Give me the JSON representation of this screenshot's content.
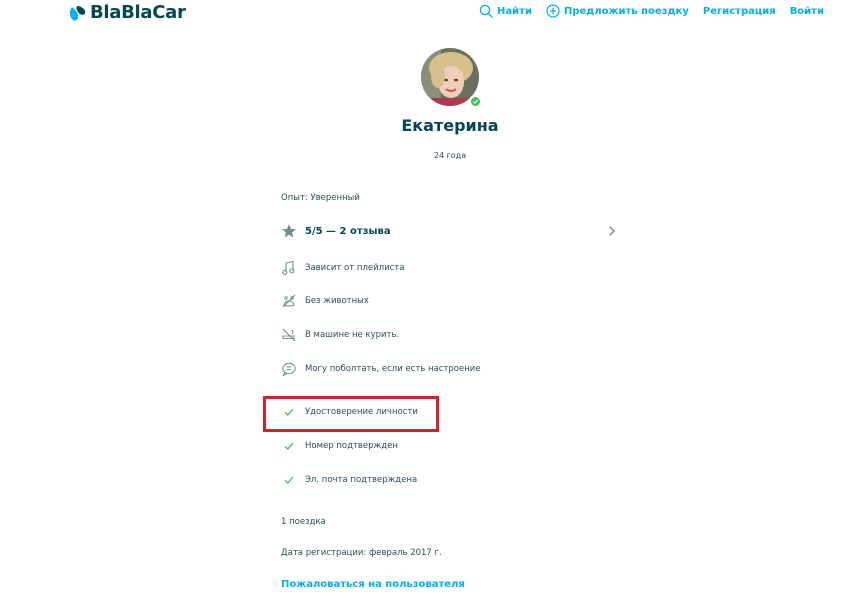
{
  "header": {
    "logo_text": "BlaBlaCar",
    "nav": {
      "search": "Найти",
      "offer": "Предложить поездку",
      "register": "Регистрация",
      "login": "Войти"
    }
  },
  "profile": {
    "name": "Екатерина",
    "age": "24 года",
    "experience": "Опыт: Уверенный",
    "rating": "5/5 — 2 отзыва",
    "preferences": [
      {
        "icon": "music-icon",
        "label": "Зависит от плейлиста"
      },
      {
        "icon": "no-pets-icon",
        "label": "Без животных"
      },
      {
        "icon": "no-smoking-icon",
        "label": "В машине не курить."
      },
      {
        "icon": "chat-icon",
        "label": "Могу поболтать, если есть настроение"
      }
    ],
    "verifications": [
      "Удостоверение личности",
      "Номер подтвержден",
      "Эл. почта подтверждена"
    ],
    "rides": "1 поездка",
    "member_since": "Дата регистрации: февраль 2017 г.",
    "report_link": "Пожаловаться на пользователя"
  },
  "colors": {
    "brand": "#054752",
    "accent": "#00aff5",
    "verified": "#3fc25e",
    "highlight": "#d1232a"
  }
}
